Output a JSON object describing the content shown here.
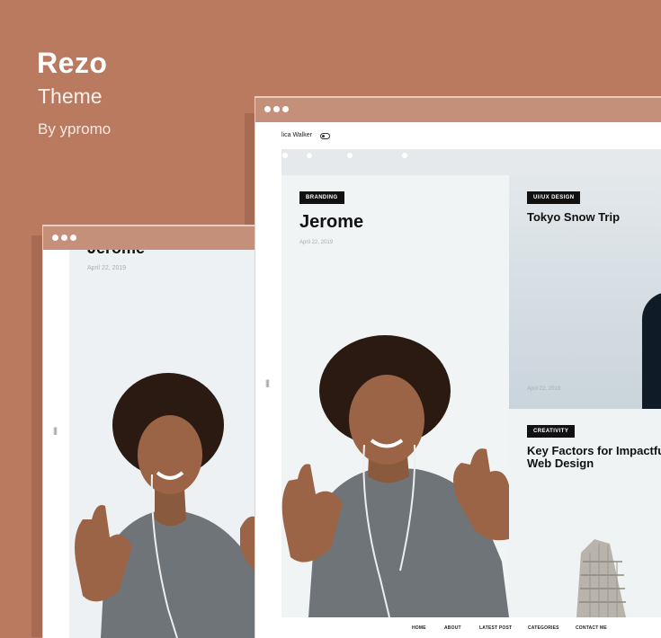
{
  "brand": {
    "title": "Rezo",
    "subtitle": "Theme",
    "byline": "By ypromo"
  },
  "colors": {
    "background": "#b97a60",
    "titlebar": "#c4907a",
    "tag_bg": "#111111"
  },
  "left_window": {
    "heading": "Jerome",
    "date": "April 22, 2019"
  },
  "right_window": {
    "user_name": "lica Walker",
    "main_card": {
      "tag": "BRANDING",
      "title": "Jerome",
      "date": "April 22, 2019"
    },
    "top_right_card": {
      "tag": "UI/UX DESIGN",
      "title": "Tokyo Snow Trip",
      "date": "April 22, 2019"
    },
    "bottom_right_card": {
      "tag": "CREATIVITY",
      "title": "Key Factors for Impactful Web Design"
    },
    "footer_nav": [
      "HOME",
      "ABOUT",
      "LATEST POST",
      "CATEGORIES",
      "CONTACT ME"
    ]
  },
  "icons": {
    "window_dots": "three-dots-icon",
    "toggle": "toggle-icon",
    "drag_handle": "drag-handle-icon"
  }
}
